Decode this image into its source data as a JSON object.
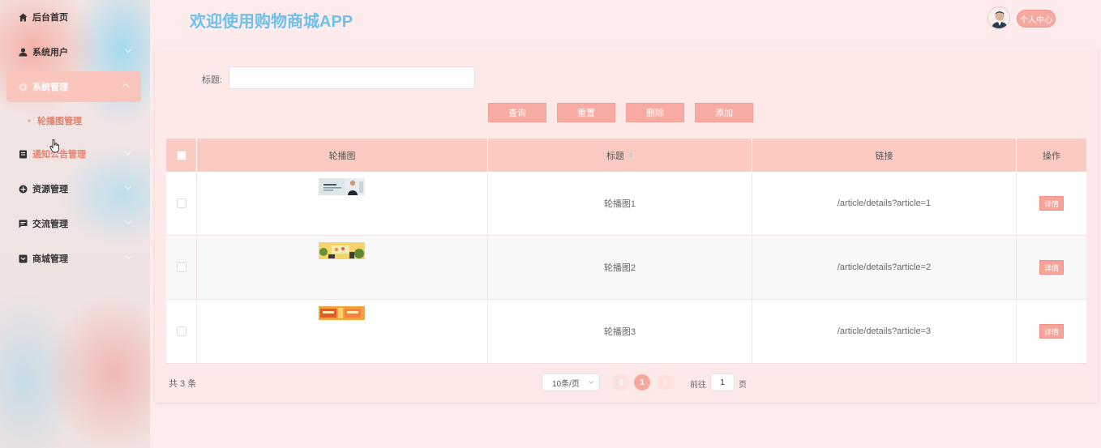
{
  "app_title": "欢迎使用购物商城APP",
  "header": {
    "profile_label": "个人中心"
  },
  "sidebar": {
    "items": [
      {
        "label": "后台首页",
        "icon": "home-icon"
      },
      {
        "label": "系统用户",
        "icon": "user-icon"
      },
      {
        "label": "系统管理",
        "icon": "settings-circle-icon",
        "expanded": true,
        "children": [
          {
            "label": "轮播图管理",
            "active": true
          }
        ]
      },
      {
        "label": "通知公告管理",
        "icon": "notice-icon"
      },
      {
        "label": "资源管理",
        "icon": "plus-circle-icon"
      },
      {
        "label": "交流管理",
        "icon": "chat-icon"
      },
      {
        "label": "商城管理",
        "icon": "store-icon"
      }
    ]
  },
  "search": {
    "label": "标题:",
    "value": "",
    "placeholder": ""
  },
  "actions": {
    "query": "查询",
    "reset": "重置",
    "delete": "删除",
    "add": "添加"
  },
  "table": {
    "columns": [
      "轮播图",
      "标题",
      "链接",
      "操作"
    ],
    "rows": [
      {
        "title": "轮播图1",
        "link": "/article/details?article=1",
        "action": "详情"
      },
      {
        "title": "轮播图2",
        "link": "/article/details?article=2",
        "action": "详情"
      },
      {
        "title": "轮播图3",
        "link": "/article/details?article=3",
        "action": "详情"
      }
    ]
  },
  "pagination": {
    "total_text": "共 3 条",
    "page_size": "10条/页",
    "current_page": "1",
    "goto_label": "前往",
    "goto_value": "1",
    "goto_unit": "页"
  },
  "colors": {
    "accent": "#f7aba3",
    "title_blue": "#6ec0e8",
    "header_row": "#fbcbc3",
    "page_bg": "#fdeceb"
  }
}
